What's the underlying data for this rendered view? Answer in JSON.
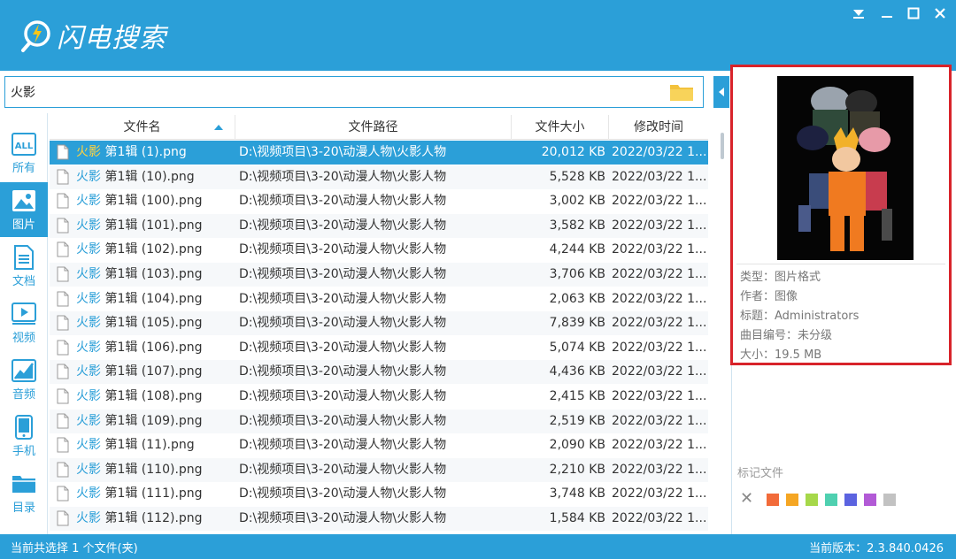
{
  "app": {
    "title": "闪电搜索"
  },
  "search": {
    "value": "火影"
  },
  "sidebar": {
    "items": [
      {
        "label": "所有",
        "icon": "all-icon"
      },
      {
        "label": "图片",
        "icon": "image-icon",
        "active": true
      },
      {
        "label": "文档",
        "icon": "document-icon"
      },
      {
        "label": "视频",
        "icon": "video-icon"
      },
      {
        "label": "音频",
        "icon": "audio-icon"
      },
      {
        "label": "手机",
        "icon": "phone-icon"
      },
      {
        "label": "目录",
        "icon": "folder-icon"
      }
    ]
  },
  "table": {
    "columns": [
      "文件名",
      "文件路径",
      "文件大小",
      "修改时间"
    ],
    "rows": [
      {
        "kw": "火影",
        "rest": " 第1辑 (1).png",
        "path": "D:\\视频项目\\3-20\\动漫人物\\火影人物",
        "size": "20,012 KB",
        "time": "2022/03/22 1..."
      },
      {
        "kw": "火影",
        "rest": " 第1辑 (10).png",
        "path": "D:\\视频项目\\3-20\\动漫人物\\火影人物",
        "size": "5,528 KB",
        "time": "2022/03/22 1..."
      },
      {
        "kw": "火影",
        "rest": " 第1辑 (100).png",
        "path": "D:\\视频项目\\3-20\\动漫人物\\火影人物",
        "size": "3,002 KB",
        "time": "2022/03/22 1..."
      },
      {
        "kw": "火影",
        "rest": " 第1辑 (101).png",
        "path": "D:\\视频项目\\3-20\\动漫人物\\火影人物",
        "size": "3,582 KB",
        "time": "2022/03/22 1..."
      },
      {
        "kw": "火影",
        "rest": " 第1辑 (102).png",
        "path": "D:\\视频项目\\3-20\\动漫人物\\火影人物",
        "size": "4,244 KB",
        "time": "2022/03/22 1..."
      },
      {
        "kw": "火影",
        "rest": " 第1辑 (103).png",
        "path": "D:\\视频项目\\3-20\\动漫人物\\火影人物",
        "size": "3,706 KB",
        "time": "2022/03/22 1..."
      },
      {
        "kw": "火影",
        "rest": " 第1辑 (104).png",
        "path": "D:\\视频项目\\3-20\\动漫人物\\火影人物",
        "size": "2,063 KB",
        "time": "2022/03/22 1..."
      },
      {
        "kw": "火影",
        "rest": " 第1辑 (105).png",
        "path": "D:\\视频项目\\3-20\\动漫人物\\火影人物",
        "size": "7,839 KB",
        "time": "2022/03/22 1..."
      },
      {
        "kw": "火影",
        "rest": " 第1辑 (106).png",
        "path": "D:\\视频项目\\3-20\\动漫人物\\火影人物",
        "size": "5,074 KB",
        "time": "2022/03/22 1..."
      },
      {
        "kw": "火影",
        "rest": " 第1辑 (107).png",
        "path": "D:\\视频项目\\3-20\\动漫人物\\火影人物",
        "size": "4,436 KB",
        "time": "2022/03/22 1..."
      },
      {
        "kw": "火影",
        "rest": " 第1辑 (108).png",
        "path": "D:\\视频项目\\3-20\\动漫人物\\火影人物",
        "size": "2,415 KB",
        "time": "2022/03/22 1..."
      },
      {
        "kw": "火影",
        "rest": " 第1辑 (109).png",
        "path": "D:\\视频项目\\3-20\\动漫人物\\火影人物",
        "size": "2,519 KB",
        "time": "2022/03/22 1..."
      },
      {
        "kw": "火影",
        "rest": " 第1辑 (11).png",
        "path": "D:\\视频项目\\3-20\\动漫人物\\火影人物",
        "size": "2,090 KB",
        "time": "2022/03/22 1..."
      },
      {
        "kw": "火影",
        "rest": " 第1辑 (110).png",
        "path": "D:\\视频项目\\3-20\\动漫人物\\火影人物",
        "size": "2,210 KB",
        "time": "2022/03/22 1..."
      },
      {
        "kw": "火影",
        "rest": " 第1辑 (111).png",
        "path": "D:\\视频项目\\3-20\\动漫人物\\火影人物",
        "size": "3,748 KB",
        "time": "2022/03/22 1..."
      },
      {
        "kw": "火影",
        "rest": " 第1辑 (112).png",
        "path": "D:\\视频项目\\3-20\\动漫人物\\火影人物",
        "size": "1,584 KB",
        "time": "2022/03/22 1..."
      }
    ]
  },
  "preview": {
    "meta": [
      "类型：图片格式",
      "作者：图像",
      "标题：Administrators",
      "曲目编号：未分级",
      "大小：19.5 MB"
    ]
  },
  "tags": {
    "title": "标记文件",
    "colors": [
      "#f26b3a",
      "#f5a623",
      "#a6d84a",
      "#4fd0b0",
      "#5b63e0",
      "#b25ad6",
      "#c2c2c2"
    ]
  },
  "status": {
    "left": "当前共选择 1 个文件(夹)",
    "right": "当前版本：2.3.840.0426"
  },
  "colors": {
    "accent": "#2b9fd8",
    "highlight": "#ffd23f",
    "frame": "#d8232a"
  }
}
